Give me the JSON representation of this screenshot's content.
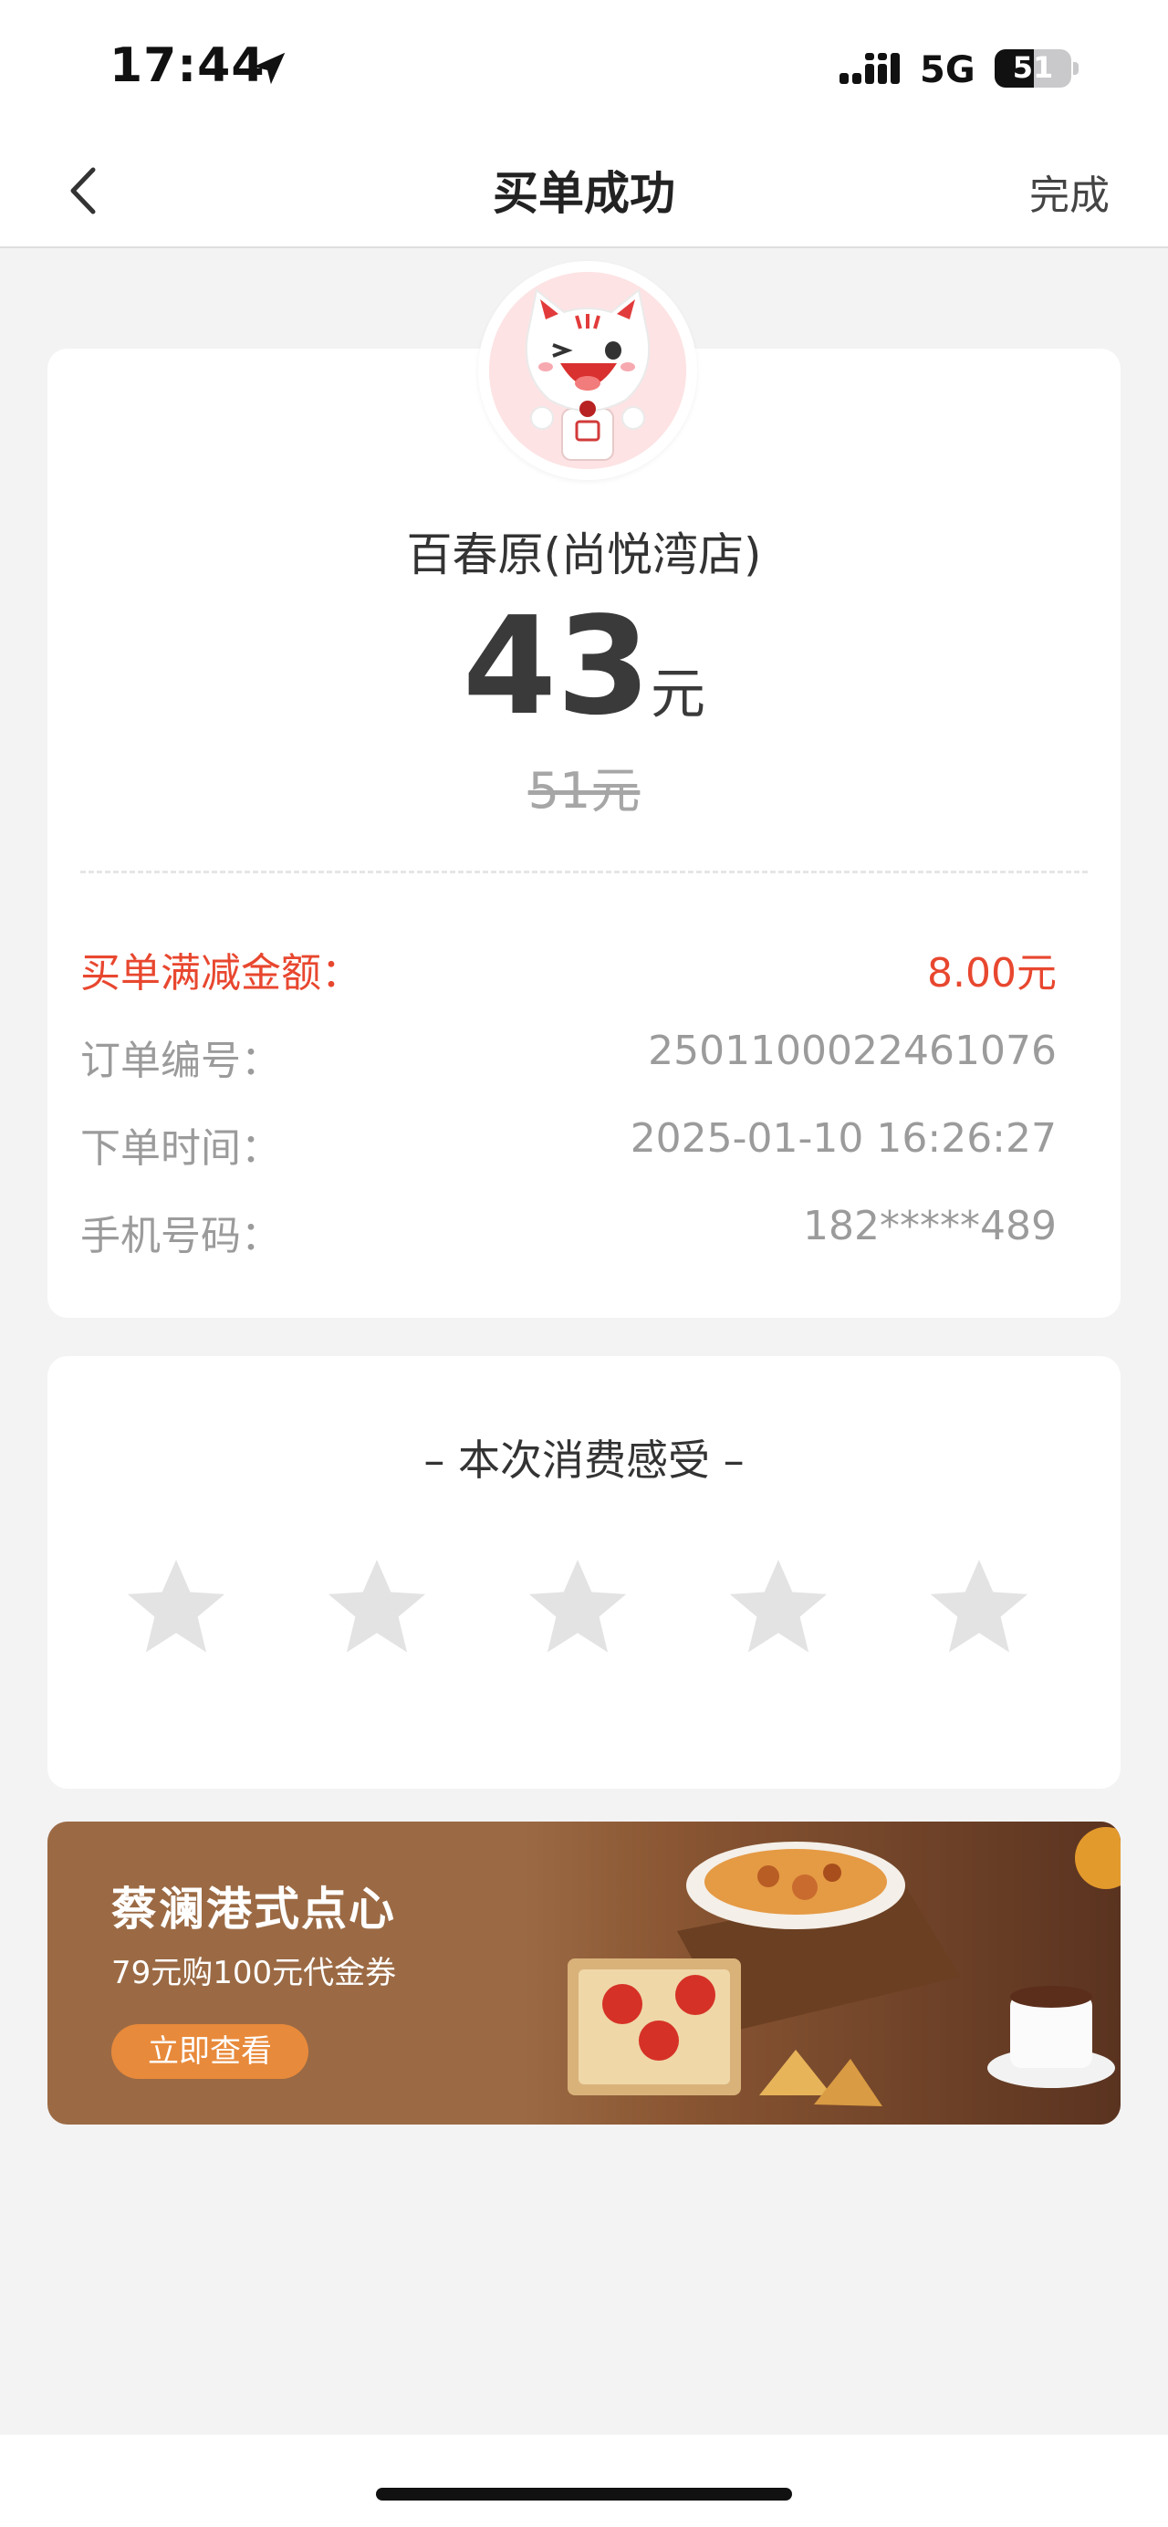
{
  "status_bar": {
    "time": "17:44",
    "network": "5G",
    "battery_level": 51,
    "battery_text": "51"
  },
  "nav": {
    "title": "买单成功",
    "done_label": "完成"
  },
  "receipt": {
    "shop_name": "百春原(尚悦湾店)",
    "amount": "43",
    "amount_unit": "元",
    "original_price": "51元",
    "rows": [
      {
        "label": "买单满减金额：",
        "value": "8.00元",
        "highlight": true
      },
      {
        "label": "订单编号：",
        "value": "2501100022461076",
        "highlight": false
      },
      {
        "label": "下单时间：",
        "value": "2025-01-10 16:26:27",
        "highlight": false
      },
      {
        "label": "手机号码：",
        "value": "182*****489",
        "highlight": false
      }
    ]
  },
  "rating": {
    "title": "– 本次消费感受 –",
    "stars_total": 5,
    "stars_selected": 0
  },
  "banner": {
    "title": "蔡澜港式点心",
    "subtitle": "79元购100元代金券",
    "button_label": "立即查看"
  },
  "colors": {
    "accent_red": "#e8472f",
    "banner_bg": "#9b6a44",
    "banner_button": "#e88a3b",
    "star_empty": "#e3e3e3"
  }
}
